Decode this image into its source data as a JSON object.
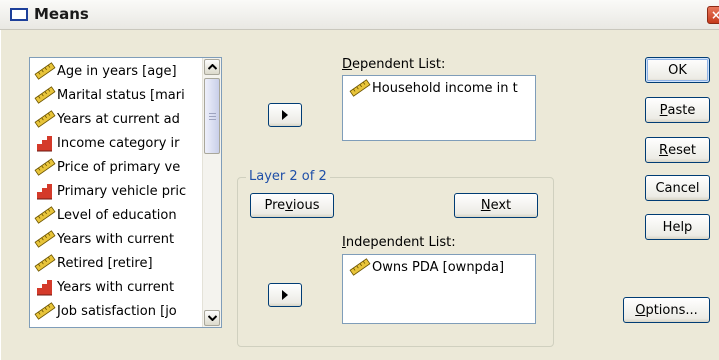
{
  "window": {
    "title": "Means",
    "close_glyph": "×"
  },
  "source_list": {
    "items": [
      {
        "label": "Age in years [age]",
        "icon": "ruler-scale-icon"
      },
      {
        "label": "Marital status [mari",
        "icon": "ruler-scale-icon"
      },
      {
        "label": "Years at current ad",
        "icon": "ruler-scale-icon"
      },
      {
        "label": "Income category ir",
        "icon": "bar-ordinal-icon"
      },
      {
        "label": "Price of primary ve",
        "icon": "ruler-scale-icon"
      },
      {
        "label": "Primary vehicle pric",
        "icon": "bar-ordinal-icon"
      },
      {
        "label": "Level of education",
        "icon": "ruler-scale-icon"
      },
      {
        "label": "Years with current",
        "icon": "ruler-scale-icon"
      },
      {
        "label": "Retired [retire]",
        "icon": "ruler-scale-icon"
      },
      {
        "label": "Years with current",
        "icon": "bar-ordinal-icon"
      },
      {
        "label": "Job satisfaction [jo",
        "icon": "ruler-scale-icon"
      }
    ]
  },
  "dependent": {
    "label_first": "D",
    "label_rest": "ependent List:",
    "items": [
      "Household income in t"
    ]
  },
  "layer": {
    "legend": "Layer 2 of 2",
    "previous_first": "Pre",
    "previous_mnemonic": "v",
    "previous_rest": "ious",
    "next_first": "",
    "next_mnemonic": "N",
    "next_rest": "ext"
  },
  "independent": {
    "label_first": "I",
    "label_rest": "ndependent List:",
    "items": [
      "Owns PDA [ownpda]"
    ]
  },
  "buttons": {
    "ok": "OK",
    "paste_m": "P",
    "paste_rest": "aste",
    "reset_m": "R",
    "reset_rest": "eset",
    "cancel": "Cancel",
    "help": "Help",
    "options_m": "O",
    "options_rest": "ptions..."
  },
  "colors": {
    "ruler_yellow": "#e8c43a",
    "bar_red": "#d43a2a",
    "legend_blue": "#1f4fa8",
    "button_border": "#003c74"
  }
}
